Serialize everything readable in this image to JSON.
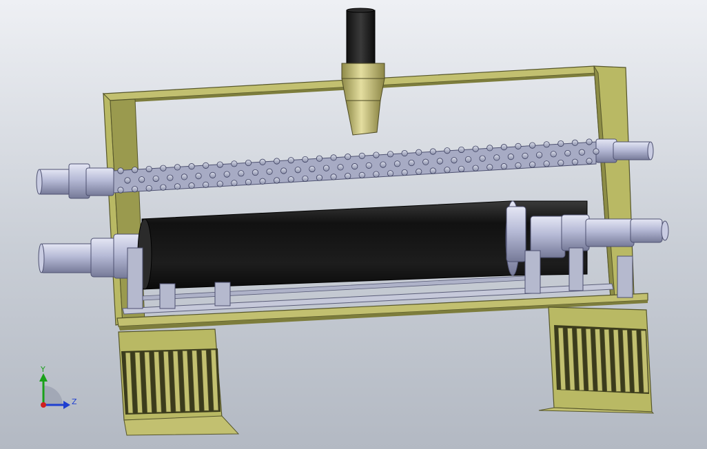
{
  "viewport": {
    "background_top": "#eef0f4",
    "background_bottom": "#b3b9c3"
  },
  "model": {
    "parts": [
      "frame",
      "nozzle",
      "spiked-roller",
      "rubber-roller",
      "left-stand",
      "right-stand"
    ],
    "colors": {
      "frame": "#b9b964",
      "frame_dark": "#7d7d3c",
      "roller_rubber": "#222222",
      "shaft": "#b8bcd6",
      "shaft_dark": "#8a8fae",
      "nozzle_tube": "#1c1c1c",
      "nozzle_body": "#c8c27a"
    }
  },
  "triad": {
    "y_label": "Y",
    "z_label": "Z",
    "y_color": "#1aa11a",
    "z_color": "#1f3fd0",
    "x_color": "#d01f1f"
  }
}
